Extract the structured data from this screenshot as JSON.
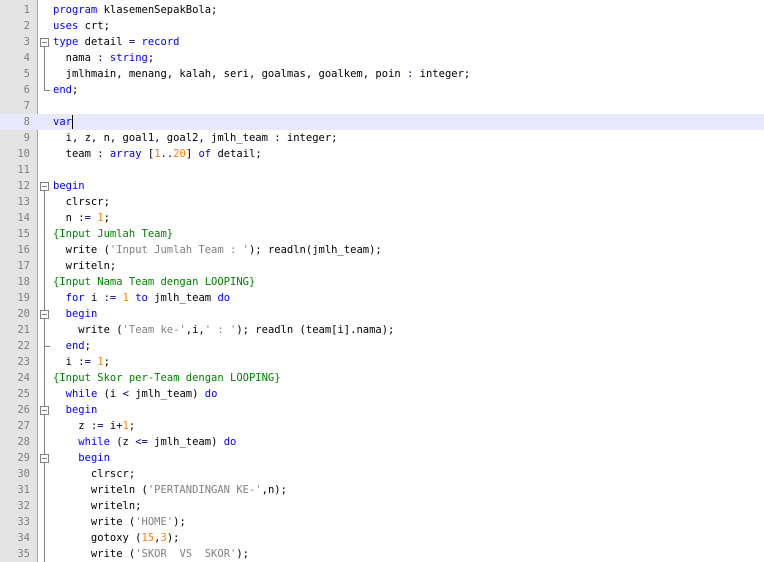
{
  "editor": {
    "colors": {
      "keyword": "#0000ff",
      "number": "#ff8000",
      "string": "#808080",
      "comment": "#008000",
      "operator": "#000080",
      "plain": "#000000",
      "current_line": "#e8e8ff",
      "gutter": "#e4e4e4"
    },
    "current_line": 8,
    "lines": [
      {
        "n": "1",
        "t": [
          [
            "kw",
            "program"
          ],
          [
            "plain",
            " klasemenSepakBola;"
          ]
        ]
      },
      {
        "n": "2",
        "t": [
          [
            "kw",
            "uses"
          ],
          [
            "plain",
            " crt;"
          ]
        ]
      },
      {
        "n": "3",
        "t": [
          [
            "kw",
            "type"
          ],
          [
            "plain",
            " detail "
          ],
          [
            "op",
            "="
          ],
          [
            "plain",
            " "
          ],
          [
            "kw",
            "record"
          ]
        ]
      },
      {
        "n": "4",
        "t": [
          [
            "plain",
            "  nama "
          ],
          [
            "op",
            ":"
          ],
          [
            "plain",
            " "
          ],
          [
            "kw",
            "string"
          ],
          [
            "plain",
            ";"
          ]
        ]
      },
      {
        "n": "5",
        "t": [
          [
            "plain",
            "  jmlhmain, menang, kalah, seri, goalmas, goalkem, poin "
          ],
          [
            "op",
            ":"
          ],
          [
            "plain",
            " integer;"
          ]
        ]
      },
      {
        "n": "6",
        "t": [
          [
            "kw",
            "end"
          ],
          [
            "plain",
            ";"
          ]
        ]
      },
      {
        "n": "7",
        "t": []
      },
      {
        "n": "8",
        "t": [
          [
            "kw",
            "var"
          ]
        ]
      },
      {
        "n": "9",
        "t": [
          [
            "plain",
            "  i, z, n, goal1, goal2, jmlh_team "
          ],
          [
            "op",
            ":"
          ],
          [
            "plain",
            " integer;"
          ]
        ]
      },
      {
        "n": "10",
        "t": [
          [
            "plain",
            "  team "
          ],
          [
            "op",
            ":"
          ],
          [
            "plain",
            " "
          ],
          [
            "kw",
            "array"
          ],
          [
            "plain",
            " ["
          ],
          [
            "num",
            "1"
          ],
          [
            "op",
            ".."
          ],
          [
            "num",
            "20"
          ],
          [
            "plain",
            "] "
          ],
          [
            "kw",
            "of"
          ],
          [
            "plain",
            " detail;"
          ]
        ]
      },
      {
        "n": "11",
        "t": []
      },
      {
        "n": "12",
        "t": [
          [
            "kw",
            "begin"
          ]
        ]
      },
      {
        "n": "13",
        "t": [
          [
            "plain",
            "  clrscr;"
          ]
        ]
      },
      {
        "n": "14",
        "t": [
          [
            "plain",
            "  n "
          ],
          [
            "op",
            ":="
          ],
          [
            "plain",
            " "
          ],
          [
            "num",
            "1"
          ],
          [
            "plain",
            ";"
          ]
        ]
      },
      {
        "n": "15",
        "t": [
          [
            "cmt",
            "{Input Jumlah Team}"
          ]
        ]
      },
      {
        "n": "16",
        "t": [
          [
            "plain",
            "  write ("
          ],
          [
            "str",
            "'Input Jumlah Team : '"
          ],
          [
            "plain",
            "); readln(jmlh_team);"
          ]
        ]
      },
      {
        "n": "17",
        "t": [
          [
            "plain",
            "  writeln;"
          ]
        ]
      },
      {
        "n": "18",
        "t": [
          [
            "cmt",
            "{Input Nama Team dengan LOOPING}"
          ]
        ]
      },
      {
        "n": "19",
        "t": [
          [
            "plain",
            "  "
          ],
          [
            "kw",
            "for"
          ],
          [
            "plain",
            " i "
          ],
          [
            "op",
            ":="
          ],
          [
            "plain",
            " "
          ],
          [
            "num",
            "1"
          ],
          [
            "plain",
            " "
          ],
          [
            "kw",
            "to"
          ],
          [
            "plain",
            " jmlh_team "
          ],
          [
            "kw",
            "do"
          ]
        ]
      },
      {
        "n": "20",
        "t": [
          [
            "plain",
            "  "
          ],
          [
            "kw",
            "begin"
          ]
        ]
      },
      {
        "n": "21",
        "t": [
          [
            "plain",
            "    write ("
          ],
          [
            "str",
            "'Team ke-'"
          ],
          [
            "plain",
            ",i,"
          ],
          [
            "str",
            "' : '"
          ],
          [
            "plain",
            "); readln (team[i].nama);"
          ]
        ]
      },
      {
        "n": "22",
        "t": [
          [
            "plain",
            "  "
          ],
          [
            "kw",
            "end"
          ],
          [
            "plain",
            ";"
          ]
        ]
      },
      {
        "n": "23",
        "t": [
          [
            "plain",
            "  i "
          ],
          [
            "op",
            ":="
          ],
          [
            "plain",
            " "
          ],
          [
            "num",
            "1"
          ],
          [
            "plain",
            ";"
          ]
        ]
      },
      {
        "n": "24",
        "t": [
          [
            "cmt",
            "{Input Skor per-Team dengan LOOPING}"
          ]
        ]
      },
      {
        "n": "25",
        "t": [
          [
            "plain",
            "  "
          ],
          [
            "kw",
            "while"
          ],
          [
            "plain",
            " (i "
          ],
          [
            "op",
            "<"
          ],
          [
            "plain",
            " jmlh_team) "
          ],
          [
            "kw",
            "do"
          ]
        ]
      },
      {
        "n": "26",
        "t": [
          [
            "plain",
            "  "
          ],
          [
            "kw",
            "begin"
          ]
        ]
      },
      {
        "n": "27",
        "t": [
          [
            "plain",
            "    z "
          ],
          [
            "op",
            ":="
          ],
          [
            "plain",
            " i"
          ],
          [
            "op",
            "+"
          ],
          [
            "num",
            "1"
          ],
          [
            "plain",
            ";"
          ]
        ]
      },
      {
        "n": "28",
        "t": [
          [
            "plain",
            "    "
          ],
          [
            "kw",
            "while"
          ],
          [
            "plain",
            " (z "
          ],
          [
            "op",
            "<="
          ],
          [
            "plain",
            " jmlh_team) "
          ],
          [
            "kw",
            "do"
          ]
        ]
      },
      {
        "n": "29",
        "t": [
          [
            "plain",
            "    "
          ],
          [
            "kw",
            "begin"
          ]
        ]
      },
      {
        "n": "30",
        "t": [
          [
            "plain",
            "      clrscr;"
          ]
        ]
      },
      {
        "n": "31",
        "t": [
          [
            "plain",
            "      writeln ("
          ],
          [
            "str",
            "'PERTANDINGAN KE-'"
          ],
          [
            "plain",
            ",n);"
          ]
        ]
      },
      {
        "n": "32",
        "t": [
          [
            "plain",
            "      writeln;"
          ]
        ]
      },
      {
        "n": "33",
        "t": [
          [
            "plain",
            "      write ("
          ],
          [
            "str",
            "'HOME'"
          ],
          [
            "plain",
            ");"
          ]
        ]
      },
      {
        "n": "34",
        "t": [
          [
            "plain",
            "      gotoxy ("
          ],
          [
            "num",
            "15"
          ],
          [
            "plain",
            ","
          ],
          [
            "num",
            "3"
          ],
          [
            "plain",
            ");"
          ]
        ]
      },
      {
        "n": "35",
        "t": [
          [
            "plain",
            "      write ("
          ],
          [
            "str",
            "'SKOR  VS  SKOR'"
          ],
          [
            "plain",
            ");"
          ]
        ]
      }
    ]
  }
}
